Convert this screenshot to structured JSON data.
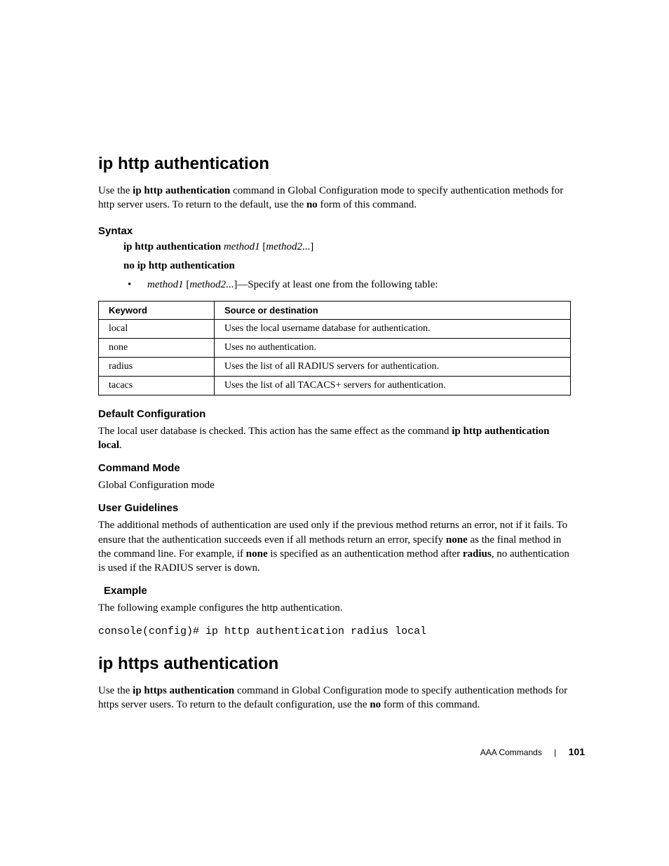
{
  "section1": {
    "title": "ip http authentication",
    "intro_a": "Use the ",
    "intro_b_bold": "ip http authentication",
    "intro_c": " command in Global Configuration mode to specify authentication methods for http server users. To return to the default, use the ",
    "intro_d_bold": "no",
    "intro_e": " form of this command.",
    "syntax_h": "Syntax",
    "syntax_cmd_bold": "ip http authentication",
    "syntax_m1": " method1 ",
    "syntax_lb": "[",
    "syntax_m2": "method2",
    "syntax_dots": "...",
    "syntax_rb": "]",
    "syntax_no": "no ip http authentication",
    "bullet_m1": "method1 ",
    "bullet_lb": "[",
    "bullet_m2": "method2",
    "bullet_dots": "...",
    "bullet_rb": "]",
    "bullet_rest": "—Specify at least one from the following table:",
    "th1": "Keyword",
    "th2": "Source or destination",
    "rows": [
      {
        "k": "local",
        "d": "Uses the local username database for authentication."
      },
      {
        "k": "none",
        "d": "Uses no authentication."
      },
      {
        "k": "radius",
        "d": "Uses the list of all RADIUS servers for authentication."
      },
      {
        "k": "tacacs",
        "d": "Uses the list of all TACACS+ servers for authentication."
      }
    ],
    "defcfg_h": "Default Configuration",
    "defcfg_a": "The local user database is checked. This action has the same effect as the command ",
    "defcfg_b_bold": "ip http authentication local",
    "defcfg_c": ".",
    "cmdmode_h": "Command Mode",
    "cmdmode_t": "Global Configuration mode",
    "ug_h": "User Guidelines",
    "ug_a": "The additional methods of authentication are used only if the previous method returns an error, not if it fails. To ensure that the authentication succeeds even if all methods return an error, specify ",
    "ug_b_bold": "none",
    "ug_c": " as the final method in the command line. For example, if ",
    "ug_d_bold": "none",
    "ug_e": " is specified as an authentication method after ",
    "ug_f_bold": "radius",
    "ug_g": ", no authentication is used if the RADIUS server is down.",
    "ex_h": "Example",
    "ex_t": "The following example configures the http authentication.",
    "console": "console(config)# ip http authentication radius local"
  },
  "section2": {
    "title": "ip https authentication",
    "intro_a": "Use the ",
    "intro_b_bold": "ip https authentication",
    "intro_c": " command in Global Configuration mode to specify authentication methods for https server users. To return to the default configuration, use the ",
    "intro_d_bold": "no",
    "intro_e": " form of this command."
  },
  "footer": {
    "section": "AAA Commands",
    "page": "101"
  }
}
